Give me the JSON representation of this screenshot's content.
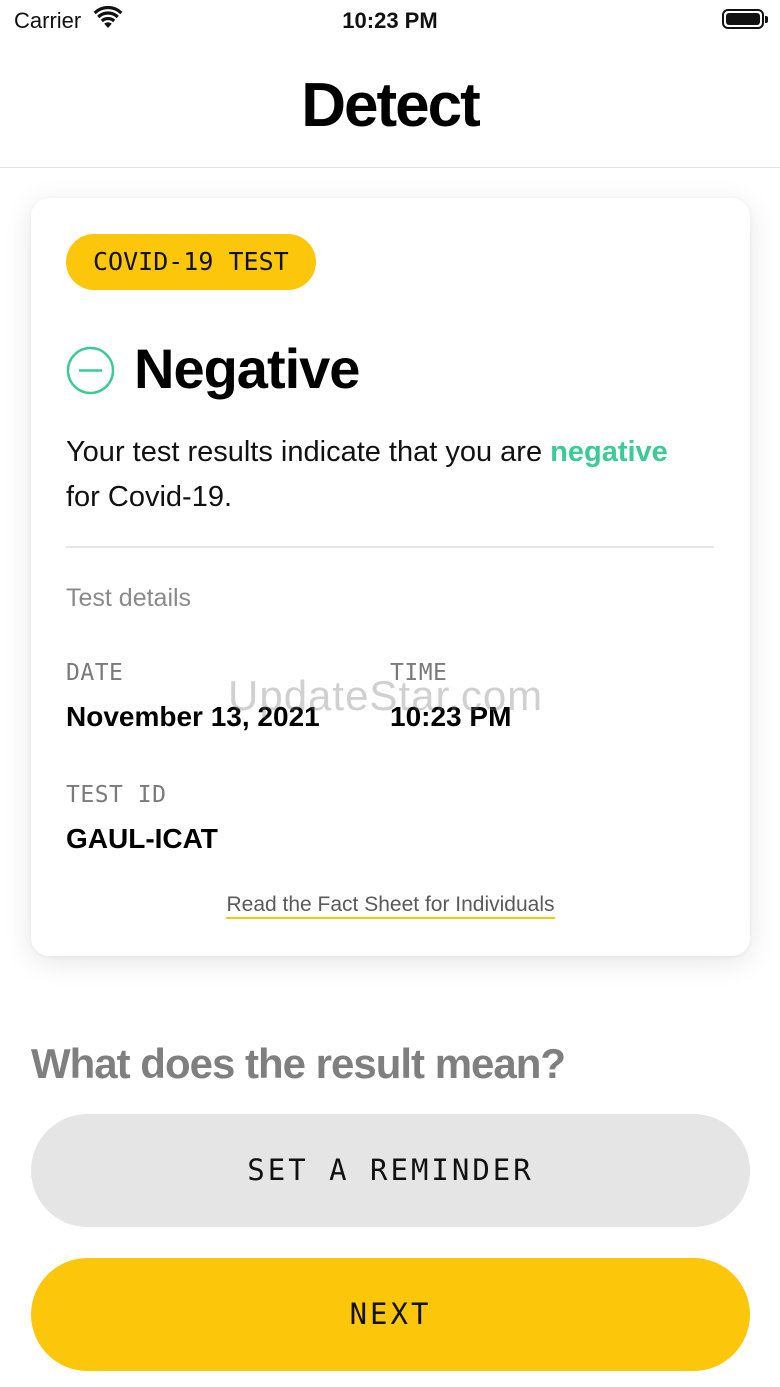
{
  "status_bar": {
    "carrier": "Carrier",
    "time": "10:23 PM",
    "wifi_icon": "wifi-icon",
    "battery_icon": "battery-icon"
  },
  "header": {
    "title": "Detect"
  },
  "card": {
    "tag": "COVID-19 TEST",
    "result_icon": "minus-circle-icon",
    "result_title": "Negative",
    "description_prefix": "Your test results indicate that you are ",
    "description_highlight": "negative",
    "description_suffix": "for Covid-19.",
    "section_label": "Test details",
    "date_label": "DATE",
    "date_value": "November 13, 2021",
    "time_label": "TIME",
    "time_value": "10:23 PM",
    "test_id_label": "TEST ID",
    "test_id_value": "GAUL-ICAT",
    "fact_sheet_link": "Read the Fact Sheet for Individuals"
  },
  "watermark": "UpdateStar.com",
  "question": "What does the result mean?",
  "buttons": {
    "reminder": "SET A REMINDER",
    "next": "NEXT"
  },
  "colors": {
    "accent_yellow": "#fcc70a",
    "negative_green": "#3ccb94",
    "secondary_button": "#e5e5e5"
  }
}
